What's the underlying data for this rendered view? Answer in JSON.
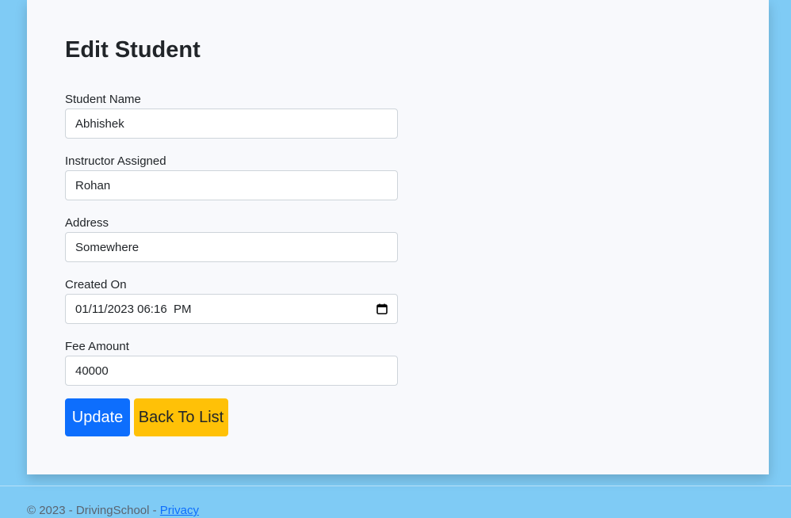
{
  "form": {
    "title": "Edit Student",
    "fields": [
      {
        "label": "Student Name",
        "value": "Abhishek"
      },
      {
        "label": "Instructor Assigned",
        "value": "Rohan"
      },
      {
        "label": "Address",
        "value": "Somewhere"
      },
      {
        "label": "Created On",
        "value": "01/11/2023 06:16  PM",
        "icon": "calendar-icon"
      },
      {
        "label": "Fee Amount",
        "value": "40000"
      }
    ],
    "update_label": "Update",
    "back_label": "Back To List"
  },
  "colors": {
    "page_background": "#7fcbf5",
    "primary": "#0d6efd",
    "warning": "#ffc107"
  },
  "footer": {
    "text": "© 2023 - DrivingSchool - ",
    "privacy_label": "Privacy"
  }
}
